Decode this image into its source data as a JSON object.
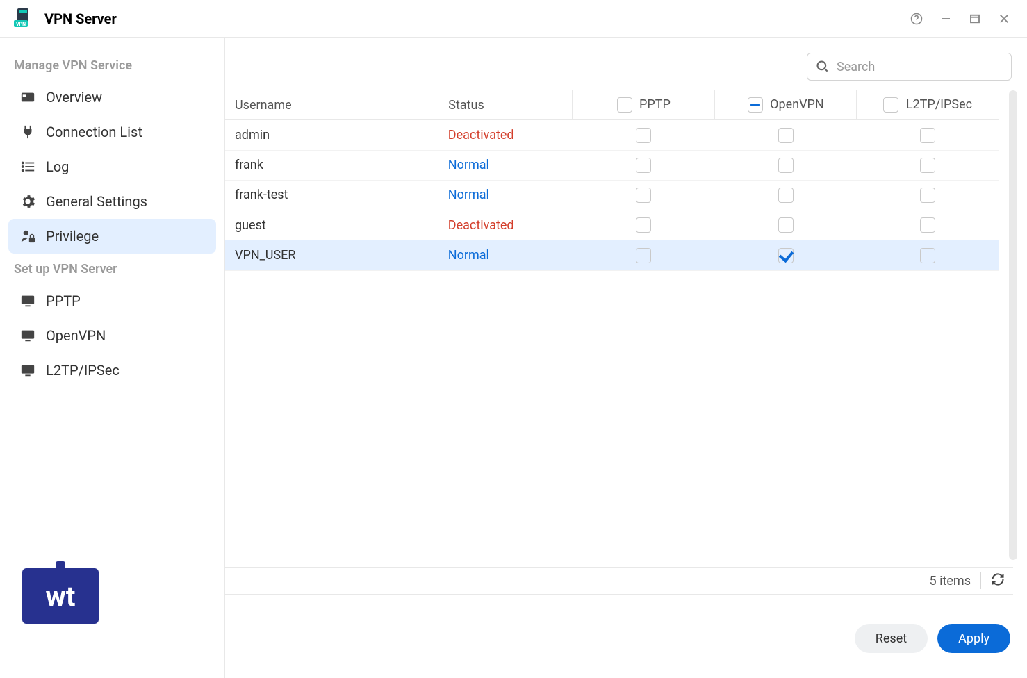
{
  "app": {
    "title": "VPN Server"
  },
  "sidebar": {
    "section1_label": "Manage VPN Service",
    "section2_label": "Set up VPN Server",
    "items1": [
      {
        "label": "Overview"
      },
      {
        "label": "Connection List"
      },
      {
        "label": "Log"
      },
      {
        "label": "General Settings"
      },
      {
        "label": "Privilege"
      }
    ],
    "items2": [
      {
        "label": "PPTP"
      },
      {
        "label": "OpenVPN"
      },
      {
        "label": "L2TP/IPSec"
      }
    ]
  },
  "search": {
    "placeholder": "Search"
  },
  "table": {
    "headers": {
      "username": "Username",
      "status": "Status",
      "pptp": "PPTP",
      "openvpn": "OpenVPN",
      "l2tp": "L2TP/IPSec"
    },
    "header_checks": {
      "pptp": "unchecked",
      "openvpn": "indeterminate",
      "l2tp": "unchecked"
    },
    "rows": [
      {
        "username": "admin",
        "status": "Deactivated",
        "status_class": "deactivated",
        "pptp": false,
        "openvpn": false,
        "l2tp": false,
        "selected": false
      },
      {
        "username": "frank",
        "status": "Normal",
        "status_class": "normal",
        "pptp": false,
        "openvpn": false,
        "l2tp": false,
        "selected": false
      },
      {
        "username": "frank-test",
        "status": "Normal",
        "status_class": "normal",
        "pptp": false,
        "openvpn": false,
        "l2tp": false,
        "selected": false
      },
      {
        "username": "guest",
        "status": "Deactivated",
        "status_class": "deactivated",
        "pptp": false,
        "openvpn": false,
        "l2tp": false,
        "selected": false
      },
      {
        "username": "VPN_USER",
        "status": "Normal",
        "status_class": "normal",
        "pptp": false,
        "openvpn": true,
        "l2tp": false,
        "selected": true
      }
    ]
  },
  "status_bar": {
    "count_text": "5 items"
  },
  "footer": {
    "reset_label": "Reset",
    "apply_label": "Apply"
  },
  "logo_text": "wt"
}
